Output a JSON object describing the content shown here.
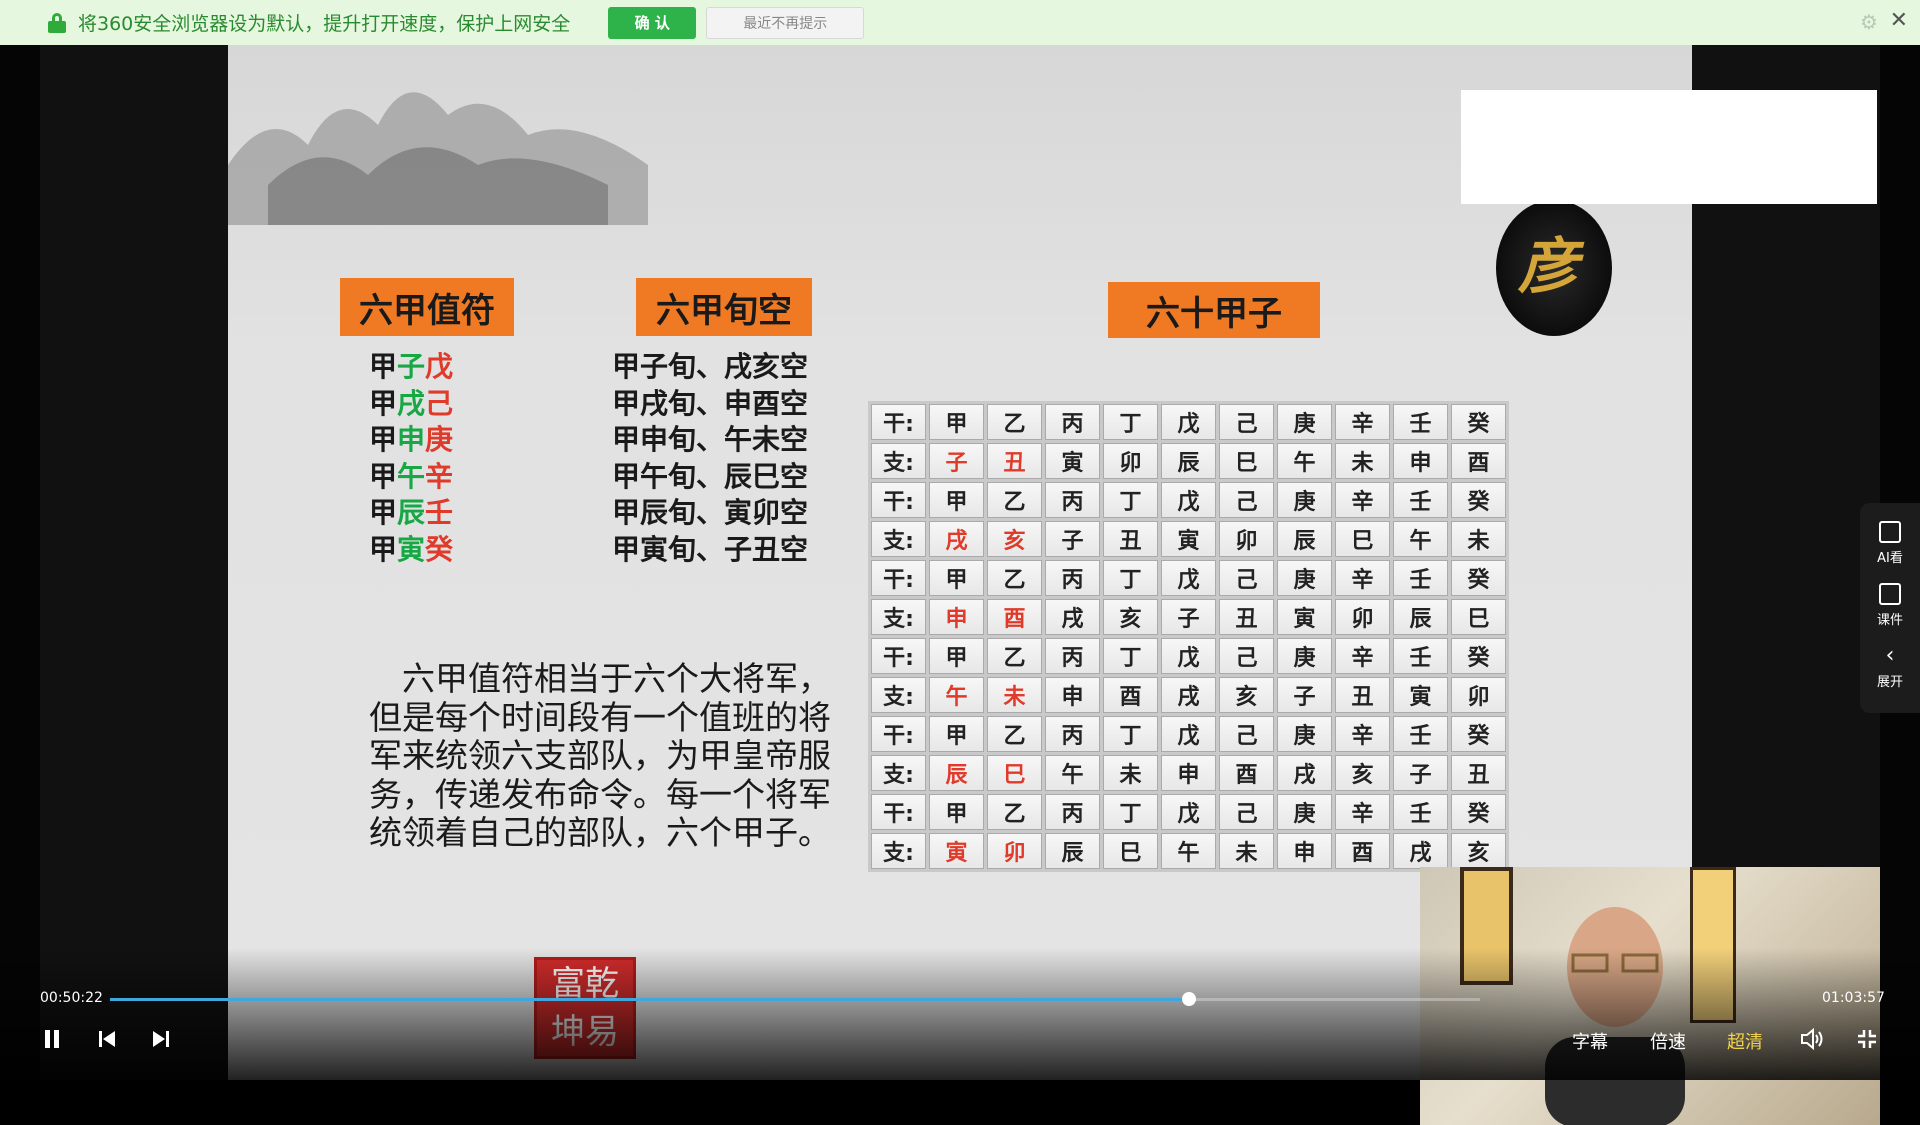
{
  "notify": {
    "message": "将360安全浏览器设为默认，提升打开速度，保护上网安全",
    "confirm_label": "确 认",
    "dismiss_label": "最近不再提示",
    "close_glyph": "✕",
    "gear_glyph": "⚙"
  },
  "slide": {
    "col1": {
      "title": "六甲值符",
      "rows": [
        {
          "a": "甲",
          "b": "子",
          "c": "戊"
        },
        {
          "a": "甲",
          "b": "戌",
          "c": "己"
        },
        {
          "a": "甲",
          "b": "申",
          "c": "庚"
        },
        {
          "a": "甲",
          "b": "午",
          "c": "辛"
        },
        {
          "a": "甲",
          "b": "辰",
          "c": "壬"
        },
        {
          "a": "甲",
          "b": "寅",
          "c": "癸"
        }
      ]
    },
    "col2": {
      "title": "六甲旬空",
      "rows": [
        "甲子旬、戌亥空",
        "甲戌旬、申酉空",
        "甲申旬、午未空",
        "甲午旬、辰巳空",
        "甲辰旬、寅卯空",
        "甲寅旬、子丑空"
      ]
    },
    "col3": {
      "title": "六十甲子",
      "rows": [
        {
          "label": "干:",
          "cells": [
            "甲",
            "乙",
            "丙",
            "丁",
            "戊",
            "己",
            "庚",
            "辛",
            "壬",
            "癸"
          ]
        },
        {
          "label": "支:",
          "cells": [
            "子",
            "丑",
            "寅",
            "卯",
            "辰",
            "巳",
            "午",
            "未",
            "申",
            "酉"
          ]
        },
        {
          "label": "干:",
          "cells": [
            "甲",
            "乙",
            "丙",
            "丁",
            "戊",
            "己",
            "庚",
            "辛",
            "壬",
            "癸"
          ]
        },
        {
          "label": "支:",
          "cells": [
            "戌",
            "亥",
            "子",
            "丑",
            "寅",
            "卯",
            "辰",
            "巳",
            "午",
            "未"
          ]
        },
        {
          "label": "干:",
          "cells": [
            "甲",
            "乙",
            "丙",
            "丁",
            "戊",
            "己",
            "庚",
            "辛",
            "壬",
            "癸"
          ]
        },
        {
          "label": "支:",
          "cells": [
            "申",
            "酉",
            "戌",
            "亥",
            "子",
            "丑",
            "寅",
            "卯",
            "辰",
            "巳"
          ]
        },
        {
          "label": "干:",
          "cells": [
            "甲",
            "乙",
            "丙",
            "丁",
            "戊",
            "己",
            "庚",
            "辛",
            "壬",
            "癸"
          ]
        },
        {
          "label": "支:",
          "cells": [
            "午",
            "未",
            "申",
            "酉",
            "戌",
            "亥",
            "子",
            "丑",
            "寅",
            "卯"
          ]
        },
        {
          "label": "干:",
          "cells": [
            "甲",
            "乙",
            "丙",
            "丁",
            "戊",
            "己",
            "庚",
            "辛",
            "壬",
            "癸"
          ]
        },
        {
          "label": "支:",
          "cells": [
            "辰",
            "巳",
            "午",
            "未",
            "申",
            "酉",
            "戌",
            "亥",
            "子",
            "丑"
          ]
        },
        {
          "label": "干:",
          "cells": [
            "甲",
            "乙",
            "丙",
            "丁",
            "戊",
            "己",
            "庚",
            "辛",
            "壬",
            "癸"
          ]
        },
        {
          "label": "支:",
          "cells": [
            "寅",
            "卯",
            "辰",
            "巳",
            "午",
            "未",
            "申",
            "酉",
            "戌",
            "亥"
          ]
        }
      ]
    },
    "paragraph": "　六甲值符相当于六个大将军，但是每个时间段有一个值班的将军来统领六支部队，为甲皇帝服务，传递发布命令。每一个将军统领着自己的部队，六个甲子。",
    "seal_chars": [
      "富",
      "乾",
      "坤",
      "易"
    ]
  },
  "player": {
    "current_time": "00:50:22",
    "total_time": "01:03:57",
    "progress": 0.7876,
    "buttons": {
      "subtitle": "字幕",
      "speed": "倍速",
      "quality": "超清"
    },
    "side": {
      "ai": "AI看",
      "courseware": "课件",
      "expand": "展开"
    }
  },
  "colors": {
    "accent_orange": "#f07a24",
    "green": "#17a845",
    "red": "#e03a2a",
    "progress": "#3fa6e0"
  }
}
